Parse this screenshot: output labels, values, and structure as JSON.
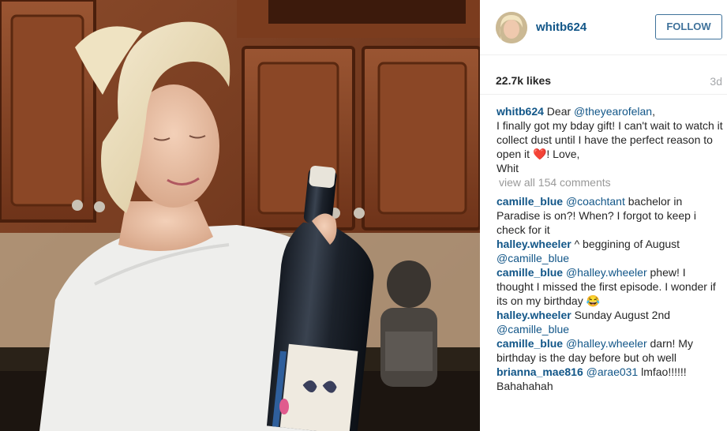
{
  "post": {
    "author": "whitb624",
    "follow_label": "FOLLOW",
    "likes": "22.7k likes",
    "time_ago": "3d"
  },
  "caption": {
    "username": "whitb624",
    "pre": " Dear ",
    "mention": "@theyearofelan",
    "line1_end": ",",
    "text": "I finally got my bday gift! I can't wait to watch it collect dust until I have the perfect reason to open it ",
    "emoji": "❤️",
    "text_end": "! Love,",
    "signoff": "Whit"
  },
  "view_all_comments": "view all 154 comments",
  "comments": [
    {
      "username": "camille_blue",
      "mention": "@coachtant",
      "text": " bachelor in Paradise is on?! When? I forgot to keep i check for it"
    },
    {
      "username": "halley.wheeler",
      "mention": "",
      "text": " ^ beggining of August",
      "mention2": "@camille_blue"
    },
    {
      "username": "camille_blue",
      "mention": "@halley.wheeler",
      "text": " phew! I thought I missed the first episode. I wonder if its on my birthday ",
      "emoji": "😂"
    },
    {
      "username": "halley.wheeler",
      "mention": "",
      "text": " Sunday August 2nd",
      "mention2": "@camille_blue"
    },
    {
      "username": "camille_blue",
      "mention": "@halley.wheeler",
      "text": " darn! My birthday is the day before but oh well"
    },
    {
      "username": "brianna_mae816",
      "mention": "@arae031",
      "text": " lmfao!!!!!! Bahahahah"
    }
  ],
  "icons": {
    "photo": "post-photo",
    "avatar": "user-avatar"
  },
  "colors": {
    "link": "#125688",
    "follow": "#3f729b",
    "muted": "#999999",
    "heart": "#e0001b"
  }
}
